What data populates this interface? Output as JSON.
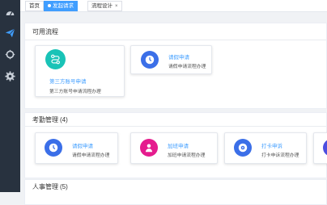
{
  "colors": {
    "sidebar_bg": "#28323f",
    "accent": "#409eff",
    "teal": "#19c3b7",
    "pink": "#e51c8e",
    "blue_icon": "#3b6fe8",
    "purple": "#4c4ee0"
  },
  "sidebar": {
    "icons": [
      "dashboard-icon",
      "send-icon",
      "target-icon",
      "settings-icon"
    ]
  },
  "tabs": [
    {
      "label": "首页",
      "active": false
    },
    {
      "label": "发起请求",
      "active": true
    },
    {
      "label": "流程设计",
      "active": false,
      "close": "×"
    }
  ],
  "sections": [
    {
      "title": "可用流程",
      "count": "",
      "cards": [
        {
          "name": "第三方账号申请",
          "desc": "第三方账号申请流程办理",
          "icon": "route-icon"
        },
        {
          "name": "请假申请",
          "desc": "请假申请流程办理",
          "icon": "clock-icon"
        }
      ]
    },
    {
      "title": "考勤管理",
      "count": "(4)",
      "cards": [
        {
          "name": "请假申请",
          "desc": "请假申请流程办理",
          "icon": "clock-icon"
        },
        {
          "name": "加班申请",
          "desc": "加班申请流程办理",
          "icon": "person-icon"
        },
        {
          "name": "打卡申诉",
          "desc": "打卡申诉流程办理",
          "icon": "location-icon"
        }
      ]
    },
    {
      "title": "人事管理",
      "count": "(5)",
      "cards": []
    }
  ]
}
